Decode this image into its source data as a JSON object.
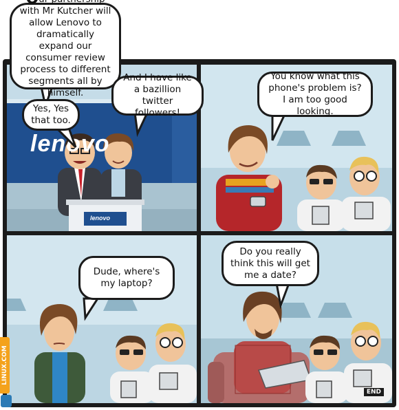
{
  "panels": [
    {
      "bubbles": [
        {
          "lead_cap": "O",
          "text": "ur partnership with Mr Kutcher will allow Lenovo to dramatically expand our consumer review process to different segments all by himself."
        },
        {
          "text": "And I have like a bazillion twitter followers!"
        },
        {
          "text": "Yes, Yes that too."
        }
      ],
      "backdrop_logo": "lenovo",
      "podium_logo": "lenovo"
    },
    {
      "bubbles": [
        {
          "text": "You know what this phone's problem is? I am too good looking."
        }
      ]
    },
    {
      "bubbles": [
        {
          "text": "Dude, where's my laptop?"
        }
      ]
    },
    {
      "bubbles": [
        {
          "text": "Do you really think this will get me a date?"
        }
      ],
      "end_label": "END"
    }
  ],
  "side_badge": "LINUX.COM",
  "colors": {
    "frame": "#1b1b1b",
    "lenovo_blue": "#1f4f8f",
    "badge_orange": "#f4a21c",
    "lab_coat": "#f2f2f2",
    "hair_brown": "#7a4a26"
  }
}
